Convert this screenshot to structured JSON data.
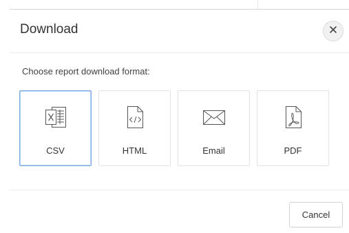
{
  "dialog": {
    "title": "Download",
    "prompt": "Choose report download format:",
    "close_icon": "close-icon",
    "formats": [
      {
        "label": "CSV",
        "icon": "csv-spreadsheet-icon",
        "selected": true
      },
      {
        "label": "HTML",
        "icon": "html-code-file-icon",
        "selected": false
      },
      {
        "label": "Email",
        "icon": "envelope-icon",
        "selected": false
      },
      {
        "label": "PDF",
        "icon": "pdf-file-icon",
        "selected": false
      }
    ],
    "cancel_label": "Cancel"
  },
  "colors": {
    "selected_border": "#7aa7e6",
    "text": "#333333",
    "border": "#e2e2e2"
  }
}
